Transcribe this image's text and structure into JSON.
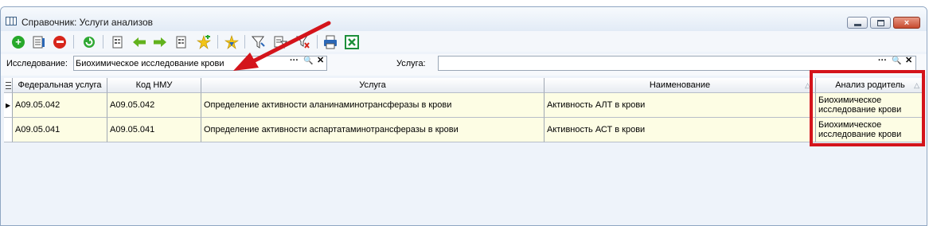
{
  "window": {
    "title": "Справочник: Услуги анализов",
    "close_glyph": "×"
  },
  "toolbar": {
    "icons": [
      "add-icon",
      "edit-icon",
      "delete-icon",
      "refresh-icon",
      "card-icon",
      "arrow-left-icon",
      "arrow-right-icon",
      "card2-icon",
      "star-add-icon",
      "star-down-icon",
      "filter-icon",
      "filter-edit-icon",
      "filter-clear-icon",
      "print-icon",
      "excel-icon"
    ]
  },
  "filters": {
    "study_label": "Исследование:",
    "study_value": "Биохимическое исследование крови",
    "service_label": "Услуга:",
    "service_value": "",
    "dots_glyph": "···",
    "search_glyph": "🔍",
    "clear_glyph": "✕"
  },
  "grid": {
    "columns": [
      "Федеральная услуга",
      "Код НМУ",
      "Услуга",
      "Наименование",
      "Анализ родитель"
    ],
    "sort_glyph": "△",
    "current_row_glyph": "▶",
    "rows": [
      {
        "federal": "A09.05.042",
        "nmu": "A09.05.042",
        "service": "Определение активности аланинаминотрансферазы в крови",
        "name": "Активность АЛТ в крови",
        "parent": "Биохимическое исследование крови"
      },
      {
        "federal": "A09.05.041",
        "nmu": "A09.05.041",
        "service": "Определение активности аспартатаминотрансферазы в крови",
        "name": "Активность АСТ в крови",
        "parent": "Биохимическое исследование крови"
      }
    ]
  },
  "annotation": {
    "color": "#d4141b"
  }
}
